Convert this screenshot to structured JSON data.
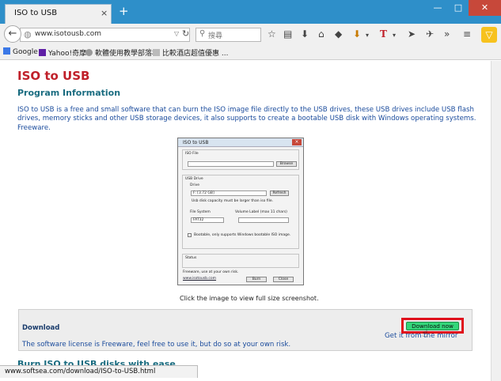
{
  "browser": {
    "tab_title": "ISO to USB",
    "tab_close": "×",
    "new_tab": "+",
    "window_buttons": {
      "minimize": "—",
      "maximize": "□",
      "close": "✕"
    },
    "url": "www.isotousb.com",
    "search_placeholder": "搜尋",
    "bookmarks": [
      {
        "label": "Google"
      },
      {
        "label": "Yahoo!奇摩"
      },
      {
        "label": "軟體使用教學部落格"
      },
      {
        "label": "比較酒店超值優惠 ..."
      }
    ]
  },
  "page": {
    "title": "ISO to USB",
    "section_title": "Program Information",
    "description": "ISO to USB is a free and small software that can burn the ISO image file directly to the USB drives, these USB drives include USB flash drives, memory sticks and other USB storage devices, it also supports to create a bootable USB disk with Windows operating systems. Freeware.",
    "screenshot": {
      "window_title": "ISO to USB",
      "iso_file_label": "ISO File",
      "browse": "Browse",
      "usb_drive_label": "USB Drive",
      "drive_label": "Drive",
      "drive_value": "F: [3.72 GB]",
      "refresh": "Refresh",
      "capacity_note": "Usb disk capacity must be larger than iso file.",
      "file_system_label": "File System",
      "file_system_value": "FAT32",
      "volume_label": "Volume Label (max 11 chars)",
      "bootable_label": "Bootable, only supports Windows bootable ISO image.",
      "status_label": "Status",
      "freeware_note": "Freeware, use at your own risk.",
      "site_link": "www.isotousb.com",
      "burn": "Burn",
      "close": "Close"
    },
    "caption": "Click the image to view full size screenshot.",
    "download": {
      "title": "Download",
      "button": "Download now",
      "mirror": "Get it from the mirror",
      "license": "The software license is Freeware, feel free to use it, but do so at your own risk."
    },
    "next_heading": "Burn ISO to USB disks with ease"
  },
  "status_url": "www.softsea.com/download/ISO-to-USB.html"
}
